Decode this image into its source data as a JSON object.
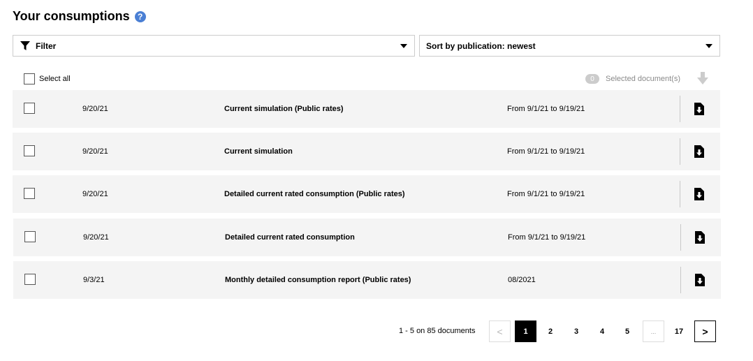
{
  "header": {
    "title": "Your consumptions",
    "help_icon": "help-icon",
    "help_glyph": "?"
  },
  "filter": {
    "label": "Filter",
    "icon": "funnel-icon"
  },
  "sort": {
    "label": "Sort by publication: newest"
  },
  "select_all": {
    "label": "Select all"
  },
  "selection": {
    "count": "0",
    "label": "Selected document(s)"
  },
  "rows": [
    {
      "date": "9/20/21",
      "name": "Current simulation (Public rates)",
      "period": "From 9/1/21 to 9/19/21"
    },
    {
      "date": "9/20/21",
      "name": "Current simulation",
      "period": "From 9/1/21 to 9/19/21"
    },
    {
      "date": "9/20/21",
      "name": "Detailed current rated consumption (Public rates)",
      "period": "From 9/1/21 to 9/19/21"
    },
    {
      "date": "9/20/21",
      "name": "Detailed current rated consumption",
      "period": "From 9/1/21 to 9/19/21"
    },
    {
      "date": "9/3/21",
      "name": "Monthly detailed consumption report (Public rates)",
      "period": "08/2021"
    }
  ],
  "pagination": {
    "summary": "1 - 5 on 85 documents",
    "prev": "<",
    "current": "1",
    "pages": [
      "2",
      "3",
      "4",
      "5"
    ],
    "ellipsis": "...",
    "last": "17",
    "next": ">"
  },
  "colors": {
    "accent": "#4a7fd4",
    "row_bg": "#f4f4f4",
    "badge_bg": "#cccccc"
  }
}
